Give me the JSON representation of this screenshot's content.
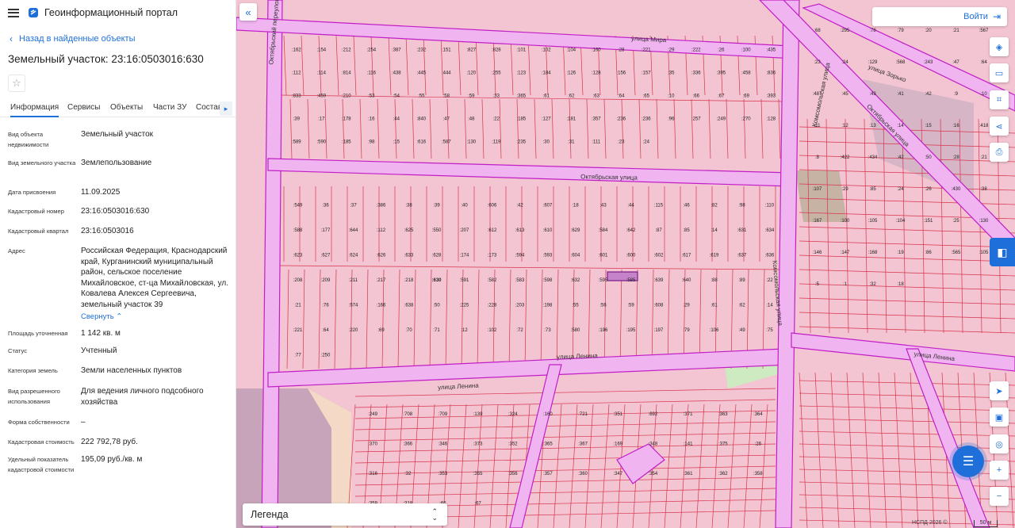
{
  "header": {
    "title": "Геоинформационный портал"
  },
  "nav": {
    "back_label": "Назад в найденные объекты"
  },
  "object": {
    "title": "Земельный участок: 23:16:0503016:630"
  },
  "tabs": [
    "Информация",
    "Сервисы",
    "Объекты",
    "Части ЗУ",
    "Состав"
  ],
  "properties": [
    {
      "label": "Вид объекта недвижимости",
      "value": "Земельный участок"
    },
    {
      "label": "Вид земельного участка",
      "value": "Землепользование"
    },
    {
      "label": "Дата присвоения",
      "value": "11.09.2025"
    },
    {
      "label": "Кадастровый номер",
      "value": "23:16:0503016:630"
    },
    {
      "label": "Кадастровый квартал",
      "value": "23:16:0503016"
    },
    {
      "label": "Адрес",
      "value": "Российская Федерация, Краснодарский край, Курганинский муниципальный район, сельское поселение Михайловское, ст-ца Михайловская, ул. Ковалева Алексея Сергеевича, земельный участок 39"
    },
    {
      "label": "Площадь уточненная",
      "value": "1 142 кв. м"
    },
    {
      "label": "Статус",
      "value": "Учтенный"
    },
    {
      "label": "Категория земель",
      "value": "Земли населенных пунктов"
    },
    {
      "label": "Вид разрешенного использования",
      "value": "Для ведения личного подсобного хозяйства"
    },
    {
      "label": "Форма собственности",
      "value": "–"
    },
    {
      "label": "Кадастровая стоимость",
      "value": "222 792,78 руб."
    },
    {
      "label": "Удельный показатель кадастровой стоимости",
      "value": "195,09 руб./кв. м"
    }
  ],
  "collapse_label": "Свернуть",
  "map": {
    "login_label": "Войти",
    "legend_label": "Легенда",
    "copyright": "НСПД 2026 ©",
    "scale_label": "50 м",
    "streets": [
      {
        "name": "улица Мира"
      },
      {
        "name": "Октябрьская улица"
      },
      {
        "name": "улица Ленина"
      },
      {
        "name": "улица Ленина"
      },
      {
        "name": "улица Ленина"
      },
      {
        "name": "улица Зорько"
      },
      {
        "name": "Октябрьская улица"
      },
      {
        "name": "Комсомольская улица"
      },
      {
        "name": "Комсомольская улица"
      },
      {
        "name": "Октябрьский переулок"
      }
    ],
    "parcel_labels": [
      ":162",
      ":154",
      ":212",
      ":254",
      ":387",
      ":232",
      ":151",
      ":827",
      ":828",
      ":101",
      ":102",
      ":104",
      ":160",
      ":28",
      ":221",
      ":29",
      ":222",
      ":26",
      ":100",
      ":435",
      ":112",
      ":114",
      ":814",
      ":116",
      ":438",
      ":445",
      ":444",
      ":120",
      ":255",
      ":123",
      ":184",
      ":126",
      ":128",
      ":156",
      ":157",
      ":35",
      ":336",
      ":395",
      ":458",
      ":836",
      ":833",
      ":459",
      ":210",
      ":53",
      ":54",
      ":55",
      ":58",
      ":59",
      ":33",
      ":365",
      ":61",
      ":62",
      ":63",
      ":64",
      ":65",
      ":10",
      ":66",
      ":67",
      ":69",
      ":393",
      ":39",
      ":17",
      ":178",
      ":16",
      ":44",
      ":840",
      ":47",
      ":48",
      ":22",
      ":185",
      ":127",
      ":181",
      ":357",
      ":236",
      ":236",
      ":96",
      ":257",
      ":249",
      ":270",
      ":128",
      ":589",
      ":590",
      ":185",
      ":98",
      ":15",
      ":616",
      ":587",
      ":130",
      ":119",
      ":235",
      ":30",
      ":31",
      ":111",
      ":23",
      ":24",
      ":549",
      ":36",
      ":37",
      ":386",
      ":38",
      ":39",
      ":40",
      ":606",
      ":42",
      ":607",
      ":18",
      ":43",
      ":44",
      ":115",
      ":46",
      ":82",
      ":98",
      ":110",
      ":588",
      ":177",
      ":644",
      ":112",
      ":625",
      ":550",
      ":207",
      ":612",
      ":613",
      ":610",
      ":629",
      ":584",
      ":642",
      ":87",
      ":85",
      ":14",
      ":631",
      ":634",
      ":623",
      ":627",
      ":624",
      ":626",
      ":633",
      ":628",
      ":174",
      ":173",
      ":594",
      ":593",
      ":604",
      ":601",
      ":600",
      ":602",
      ":617",
      ":619",
      ":637",
      ":636",
      ":208",
      ":209",
      ":211",
      ":217",
      ":218",
      ":630",
      ":591",
      ":582",
      ":583",
      ":598",
      ":632",
      ":595",
      ":585",
      ":639",
      ":640",
      ":88",
      ":89",
      ":22",
      ":21",
      ":76",
      ":574",
      ":166",
      ":638",
      ":50",
      ":225",
      ":228",
      ":203",
      ":198",
      ":55",
      ":56",
      ":59",
      ":608",
      ":29",
      ":61",
      ":62",
      ":14",
      ":221",
      ":64",
      ":220",
      ":69",
      ":70",
      ":71",
      ":12",
      ":102",
      ":72",
      ":73",
      ":580",
      ":196",
      ":195",
      ":197",
      ":79",
      ":106",
      ":49",
      ":75",
      ":77",
      ":250",
      ":249",
      ":708",
      ":709",
      ":139",
      ":324",
      ":160",
      ":721",
      ":351",
      ":692",
      ":371",
      ":363",
      ":364",
      ":370",
      ":366",
      ":346",
      ":373",
      ":352",
      ":365",
      ":367",
      ":169",
      ":348",
      ":141",
      ":375",
      ":26",
      ":316",
      ":32",
      ":353",
      ":355",
      ":356",
      ":357",
      ":360",
      ":347",
      ":354",
      ":361",
      ":362",
      ":358",
      ":359",
      ":318",
      ":66",
      ":67",
      ":68",
      ":295",
      ":78",
      ":79",
      ":20",
      ":21",
      ":567",
      ":23",
      ":24",
      ":129",
      ":568",
      ":243",
      ":47",
      ":64",
      ":487",
      ":45",
      ":43",
      ":41",
      ":42",
      ":9",
      ":10",
      ":11",
      ":12",
      ":13",
      ":14",
      ":15",
      ":16",
      ":418",
      ":8",
      ":422",
      ":434",
      ":42",
      ":50",
      ":28",
      ":21",
      ":107",
      ":29",
      ":85",
      ":24",
      ":26",
      ":430",
      ":38",
      ":167",
      ":100",
      ":105",
      ":104",
      ":151",
      ":25",
      ":130",
      ":146",
      ":147",
      ":168",
      ":19",
      ":86",
      ":565",
      ":105",
      ":5",
      ":1",
      ":32",
      ":18"
    ]
  },
  "toolbar_icons": [
    "layers-icon",
    "ruler-icon",
    "scan-icon",
    "share-icon",
    "print-icon"
  ],
  "map_controls": [
    "locate-icon",
    "screenshot-icon",
    "geolocate-icon",
    "zoom-in-icon",
    "zoom-out-icon"
  ],
  "colors": {
    "accent": "#1e6fd9",
    "parcel_fill": "#f5c6d2",
    "parcel_line": "#d8344e",
    "road": "#f0b4f0",
    "road_line": "#c21ec8"
  }
}
